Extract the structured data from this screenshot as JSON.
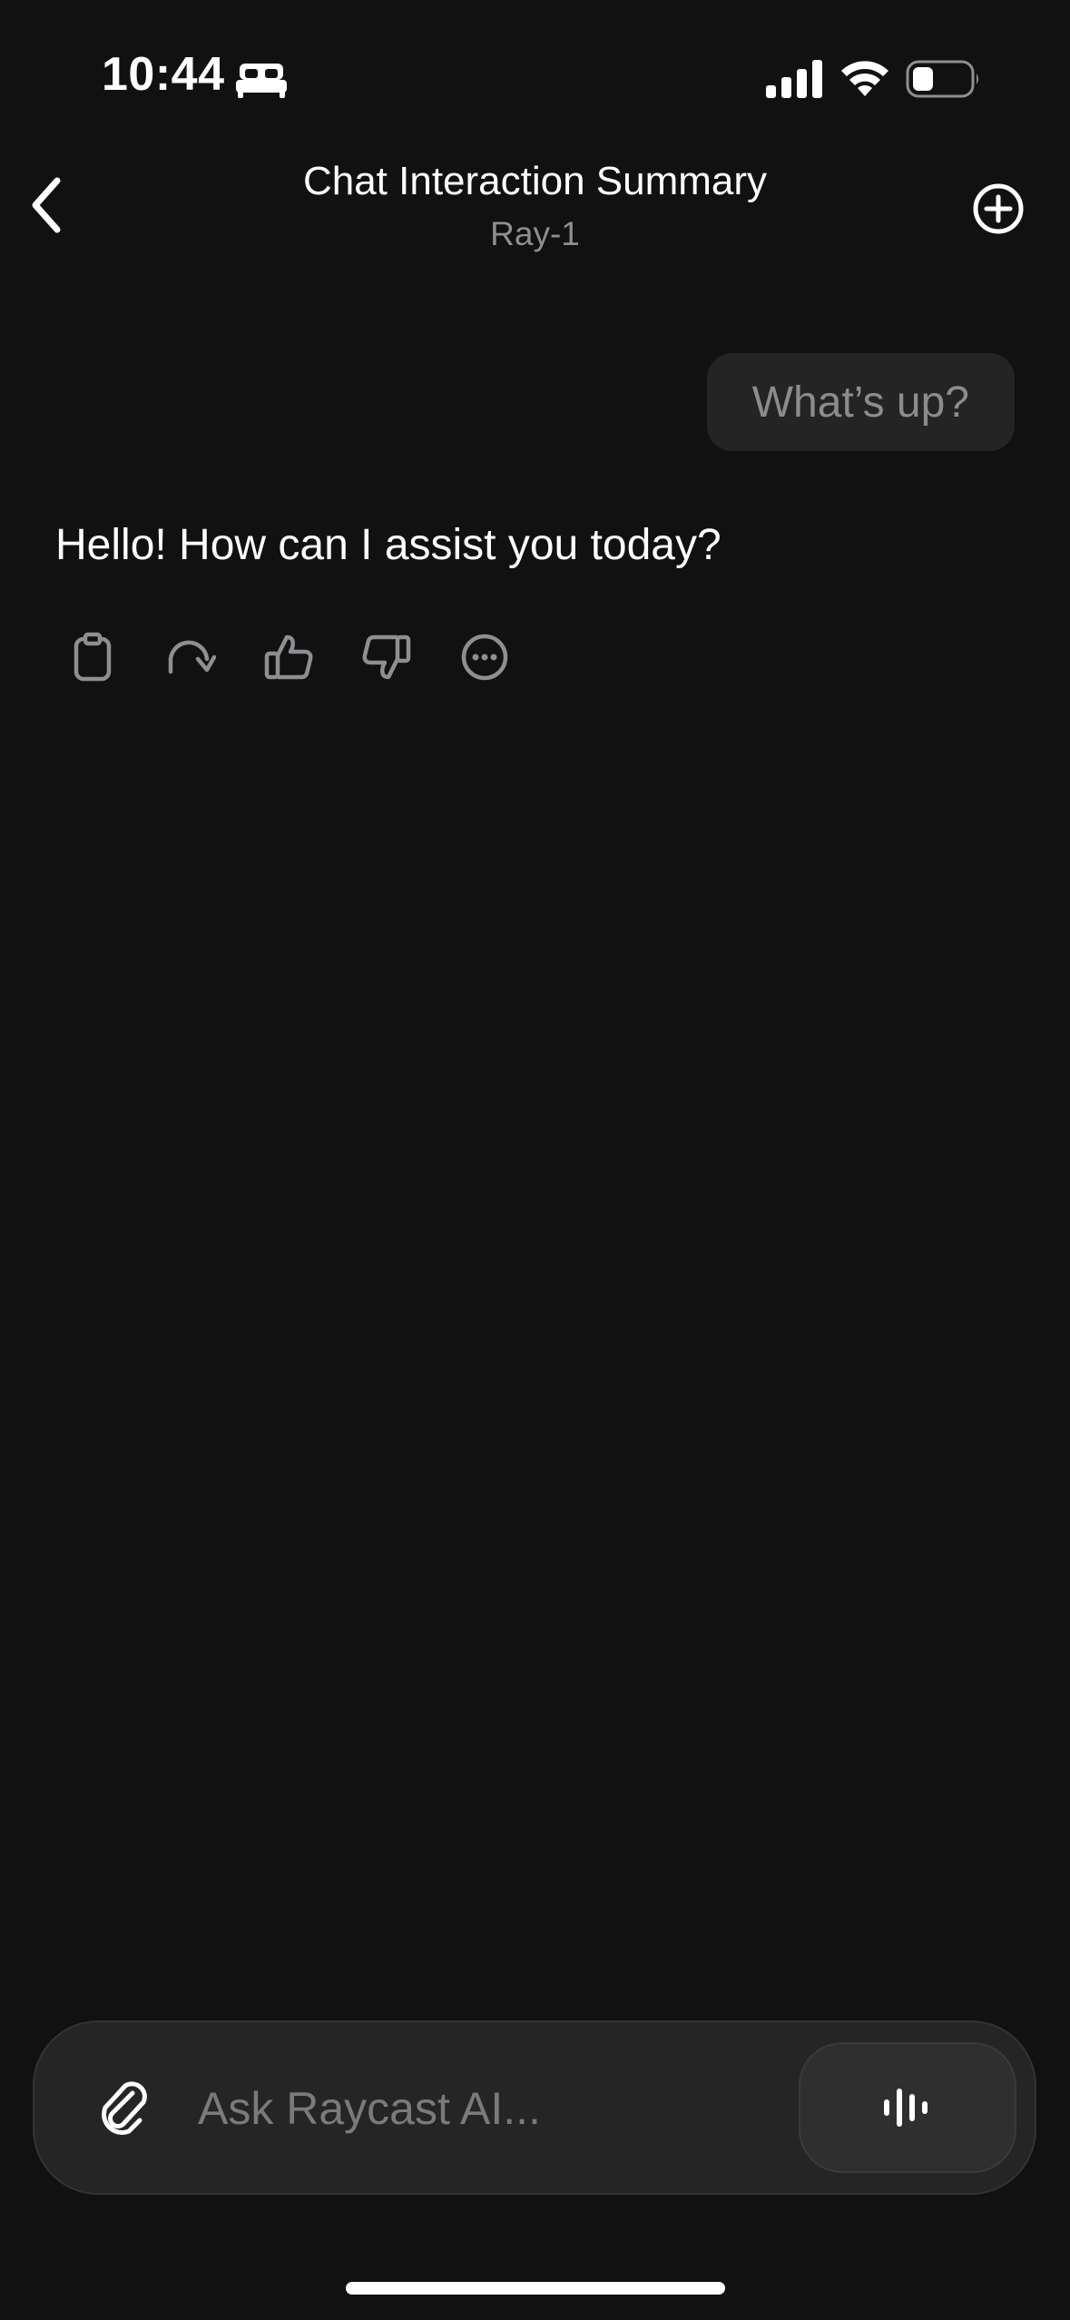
{
  "status_bar": {
    "time": "10:44",
    "icons": [
      "bed-icon",
      "signal-icon",
      "wifi-icon",
      "battery-icon"
    ]
  },
  "header": {
    "title": "Chat Interaction Summary",
    "subtitle": "Ray-1",
    "back_icon": "chevron-left-icon",
    "new_chat_icon": "plus-circle-icon"
  },
  "messages": {
    "user": "What’s up?",
    "assistant": "Hello! How can I assist you today?"
  },
  "message_actions": [
    "copy-icon",
    "regenerate-icon",
    "thumbs-up-icon",
    "thumbs-down-icon",
    "more-icon"
  ],
  "composer": {
    "placeholder": "Ask Raycast AI...",
    "attach_icon": "paperclip-icon",
    "voice_icon": "waveform-icon"
  },
  "colors": {
    "background": "#111111",
    "bubble": "#242424",
    "composer": "#252525",
    "muted_text": "#8e8e93"
  }
}
